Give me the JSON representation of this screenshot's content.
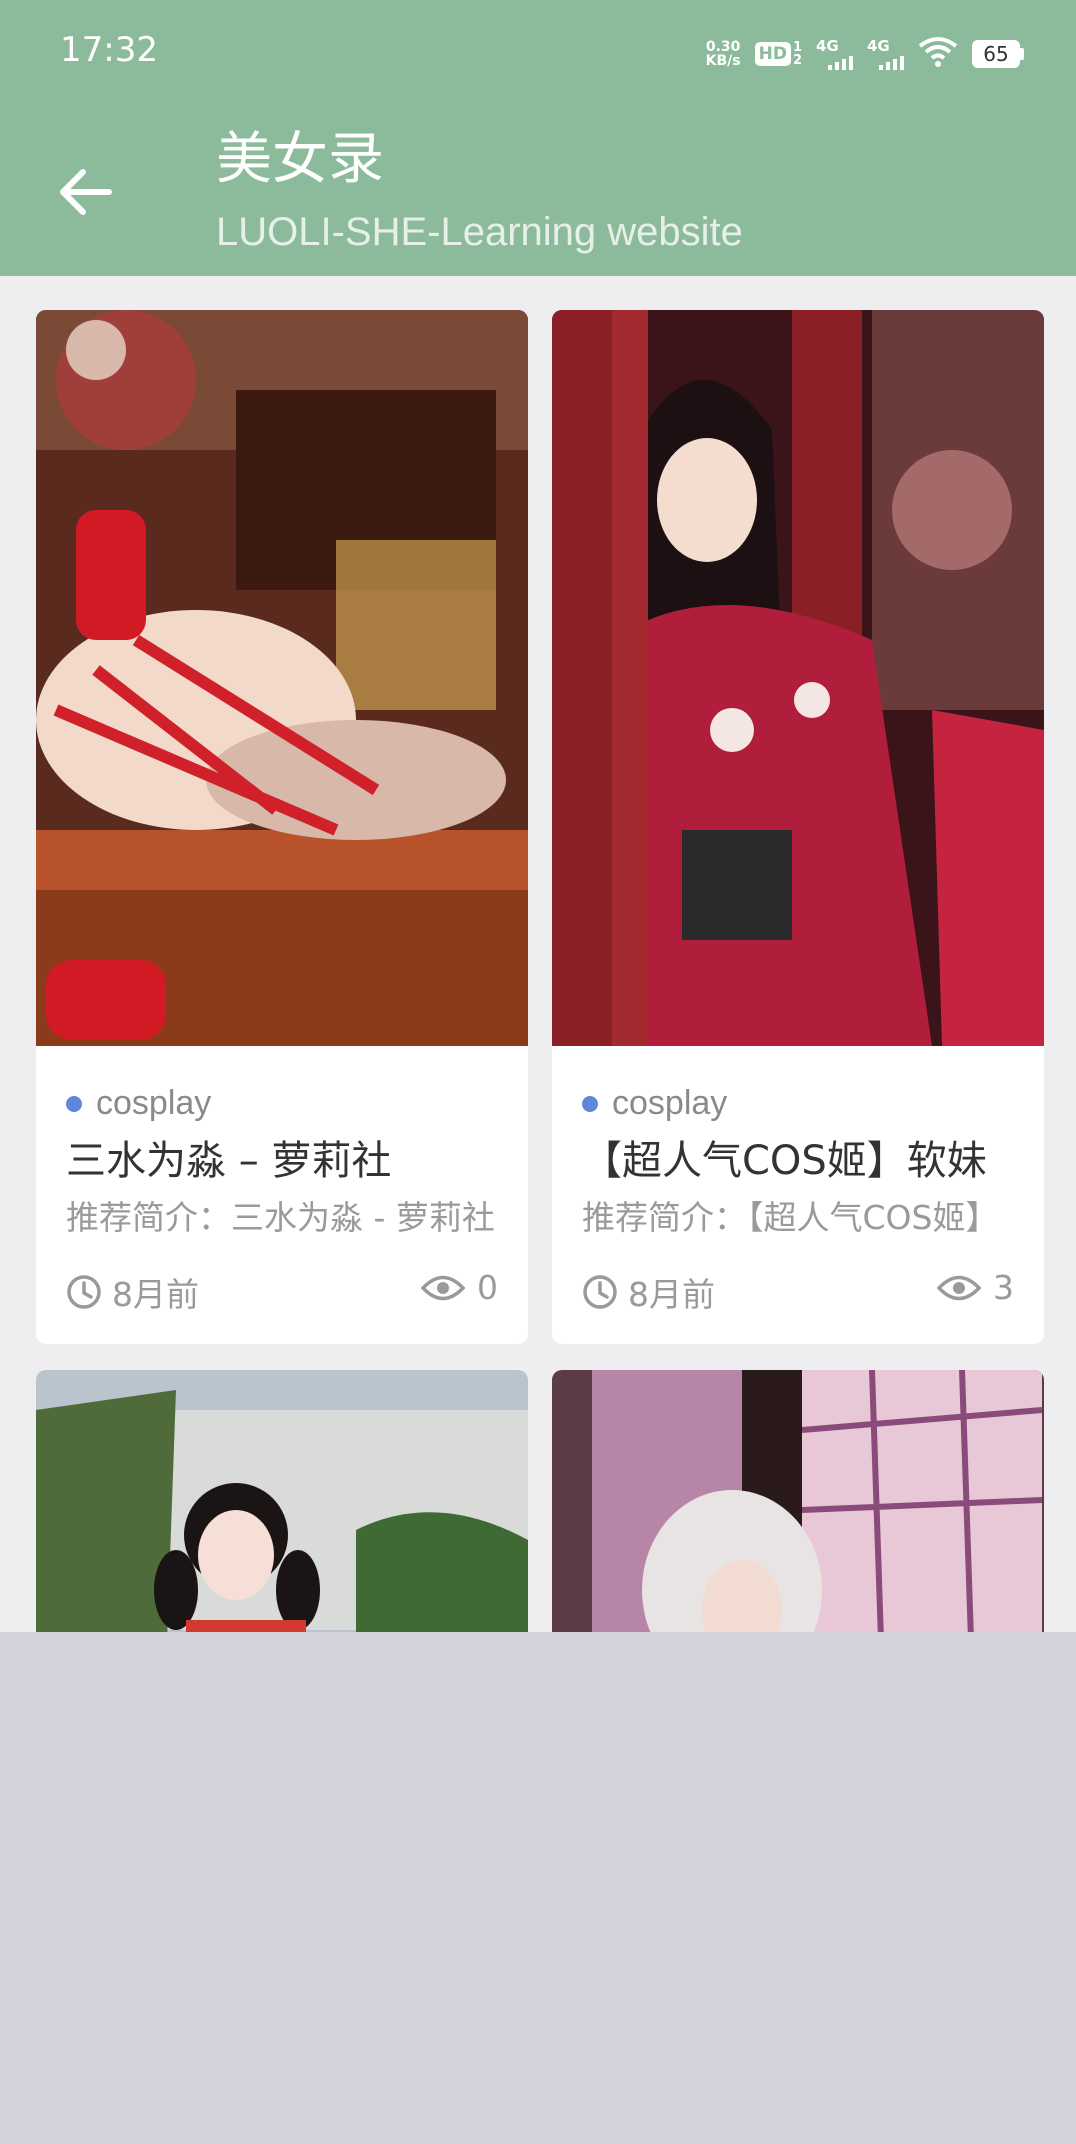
{
  "status_bar": {
    "time": "17:32",
    "net_speed_value": "0.30",
    "net_speed_unit": "KB/s",
    "hd_label": "HD",
    "hd_sub": "1",
    "hd_sub2": "2",
    "signal1": "4G",
    "signal2": "4G",
    "battery": "65"
  },
  "header": {
    "title": "美女录",
    "subtitle": "LUOLI-SHE-Learning website",
    "background_color": "#8cbb9b"
  },
  "cards": [
    {
      "category": "cosplay",
      "title": "三水为淼 – 萝莉社",
      "description": "推荐简介：三水为淼 - 萝莉社",
      "time": "8月前",
      "views": "0"
    },
    {
      "category": "cosplay",
      "title": "【超人气COS姬】软妹",
      "description": "推荐简介：【超人气COS姬】",
      "time": "8月前",
      "views": "3"
    }
  ],
  "colors": {
    "accent_dot": "#5f86d9",
    "muted_text": "#9a9a9a"
  }
}
